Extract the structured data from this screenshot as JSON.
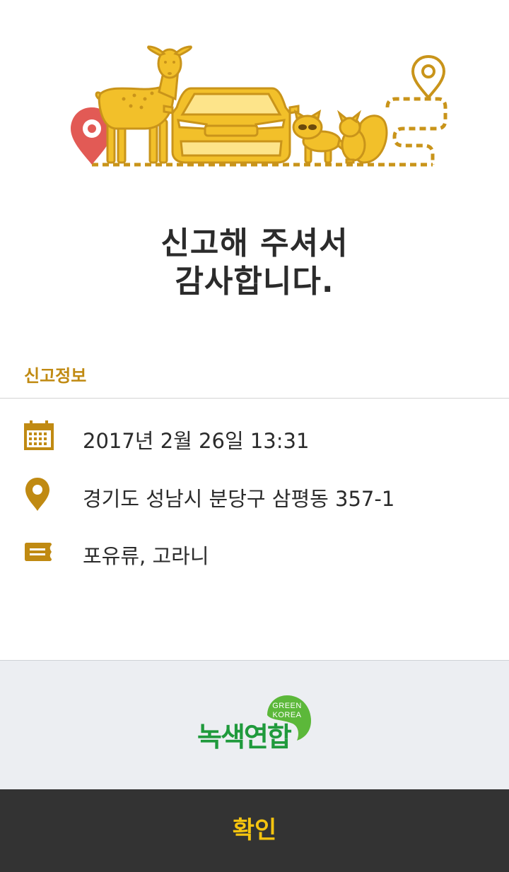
{
  "heading": {
    "line1": "신고해 주셔서",
    "line2": "감사합니다."
  },
  "report_info": {
    "title": "신고정보",
    "date": "2017년 2월 26일 13:31",
    "location": "경기도 성남시 분당구 삼평동 357-1",
    "animal": "포유류, 고라니"
  },
  "icons": {
    "date": "calendar-icon",
    "location": "location-pin-icon",
    "animal": "tag-icon",
    "hero": "roadkill-illustration"
  },
  "logo": {
    "text": "녹색연합",
    "badge_line1": "GREEN",
    "badge_line2": "KOREA"
  },
  "confirm_button": {
    "label": "확인"
  },
  "colors": {
    "accent_gold": "#c08a12",
    "illustration_yellow": "#f2c02a",
    "pin_red": "#e25a55",
    "logo_green": "#1f9a3c",
    "button_bg": "#333333",
    "button_text": "#f5c40f"
  }
}
